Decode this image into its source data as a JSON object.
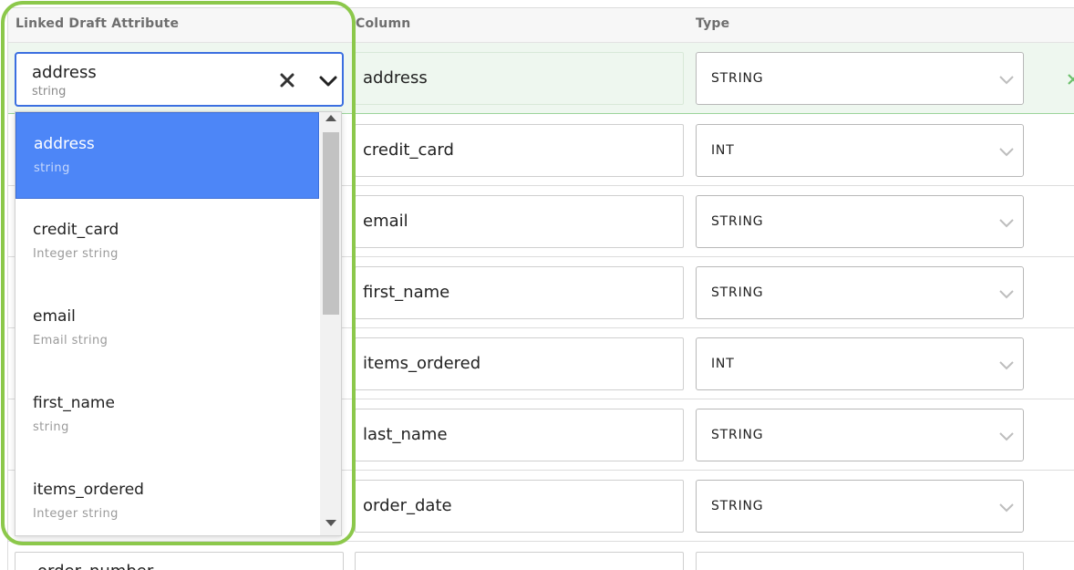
{
  "headers": {
    "linked_attr": "Linked Draft Attribute",
    "column": "Column",
    "type": "Type"
  },
  "combobox": {
    "value": "address",
    "value_subtitle": "string",
    "clear_icon": "close-icon",
    "toggle_icon": "chevron-down-icon"
  },
  "dropdown": {
    "options": [
      {
        "label": "address",
        "subtitle": "string",
        "selected": true
      },
      {
        "label": "credit_card",
        "subtitle": "Integer string"
      },
      {
        "label": "email",
        "subtitle": "Email string"
      },
      {
        "label": "first_name",
        "subtitle": "string"
      },
      {
        "label": "items_ordered",
        "subtitle": "Integer string"
      }
    ]
  },
  "rows": [
    {
      "column": "address",
      "type": "STRING"
    },
    {
      "column": "credit_card",
      "type": "INT"
    },
    {
      "column": "email",
      "type": "STRING"
    },
    {
      "column": "first_name",
      "type": "STRING"
    },
    {
      "column": "items_ordered",
      "type": "INT"
    },
    {
      "column": "last_name",
      "type": "STRING"
    },
    {
      "column": "order_date",
      "type": "STRING"
    }
  ],
  "partial_row": {
    "linked_attr": "order_number"
  },
  "colors": {
    "highlight": "#8cc84b",
    "selected_option": "#4d86f7",
    "focus_border": "#3b6fe0",
    "active_row": "#eef7ef"
  }
}
